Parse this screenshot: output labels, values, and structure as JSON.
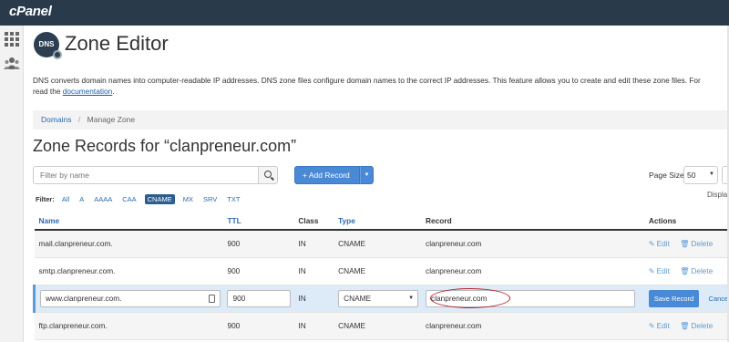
{
  "app": {
    "logo": "cPanel"
  },
  "sidebar": {
    "items": [
      {
        "icon": "apps-grid-icon"
      },
      {
        "icon": "users-icon"
      }
    ]
  },
  "header": {
    "icon_text": "DNS",
    "title": "Zone Editor"
  },
  "description": {
    "text": "DNS converts domain names into computer-readable IP addresses. DNS zone files configure domain names to the correct IP addresses. This feature allows you to create and edit these zone files. For",
    "text_line2": "read the",
    "link": "documentation",
    "end": "."
  },
  "breadcrumb": {
    "parent": "Domains",
    "separator": "/",
    "current": "Manage Zone"
  },
  "zone": {
    "title": "Zone Records for “clanpreneur.com”"
  },
  "search": {
    "placeholder": "Filter by name"
  },
  "toolbar": {
    "add_record_label": "Add Record",
    "add_record_icon": "+",
    "page_size_label": "Page Size",
    "page_size_value": "50",
    "display_label": "Displa"
  },
  "filters": {
    "label": "Filter:",
    "options": [
      "All",
      "A",
      "AAAA",
      "CAA",
      "CNAME",
      "MX",
      "SRV",
      "TXT"
    ],
    "active": "CNAME"
  },
  "table": {
    "columns": [
      "Name",
      "TTL",
      "Class",
      "Type",
      "Record",
      "Actions"
    ],
    "rows": [
      {
        "name": "mail.clanpreneur.com.",
        "ttl": "900",
        "class": "IN",
        "type": "CNAME",
        "record": "clanpreneur.com"
      },
      {
        "name": "smtp.clanpreneur.com.",
        "ttl": "900",
        "class": "IN",
        "type": "CNAME",
        "record": "clanpreneur.com"
      },
      {
        "name": "ftp.clanpreneur.com.",
        "ttl": "900",
        "class": "IN",
        "type": "CNAME",
        "record": "clanpreneur.com"
      }
    ],
    "action_edit": "Edit",
    "action_delete": "Delete"
  },
  "editing_row": {
    "name": "www.clanpreneur.com.",
    "ttl": "900",
    "class": "IN",
    "type": "CNAME",
    "record": "clanpreneur.com",
    "save_label": "Save Record",
    "cancel_label": "Cancel"
  },
  "colors": {
    "topbar": "#293a4a",
    "accent": "#4a89d6",
    "link": "#2a6bb0",
    "highlight": "#b3202a",
    "editing_row_bg": "#dcebf7"
  }
}
